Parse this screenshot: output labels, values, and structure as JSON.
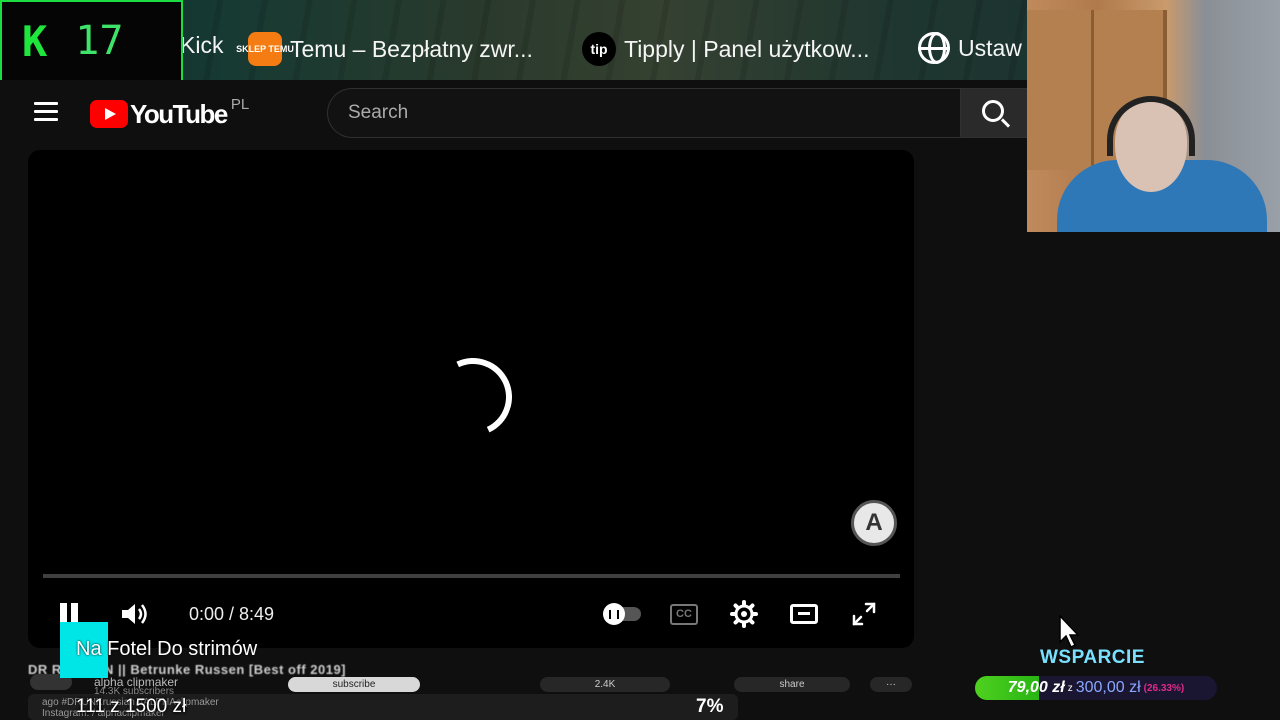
{
  "bookmarks": {
    "items": [
      {
        "label": "Kick"
      },
      {
        "label": "Temu – Bezpłatny zwr...",
        "icon_text": "SKLEP TEMU"
      },
      {
        "label": "Tipply | Panel użytkow...",
        "icon_text": "tip"
      },
      {
        "label": "Ustaw"
      }
    ]
  },
  "kick_widget": {
    "logo": "K",
    "count": "17"
  },
  "youtube": {
    "logo": "YouTube",
    "country": "PL",
    "search_placeholder": "Search"
  },
  "player": {
    "time": "0:00 / 8:49",
    "cc_label": "CC",
    "progress": 0,
    "brand_color": "#ff0000"
  },
  "video_info": {
    "title": "DR     RUSSIAN || Betrunke Russen [Best off 2019]",
    "channel": "alpha clipmaker",
    "subscribers": "14.3K subscribers",
    "subscribe_label": "subscribe",
    "likes": "2.4K",
    "share_label": "share",
    "more_label": "···",
    "desc_line1": "                 ago  #DRUNKrussian #ALPHAclipmaker",
    "desc_line2": "Instagram:        / alphaclipmaker"
  },
  "stream_goal": {
    "title": "Na Fotel Do strimów",
    "amount": "111 z 1500 zł",
    "percent": "7%",
    "accent_color": "#00e6e6"
  },
  "support": {
    "label": "WSPARCIE",
    "current": "79,00 zł",
    "separator": "z",
    "goal": "300,00 zł",
    "percent_text": "(26.33%)",
    "fraction": 0.2633
  }
}
